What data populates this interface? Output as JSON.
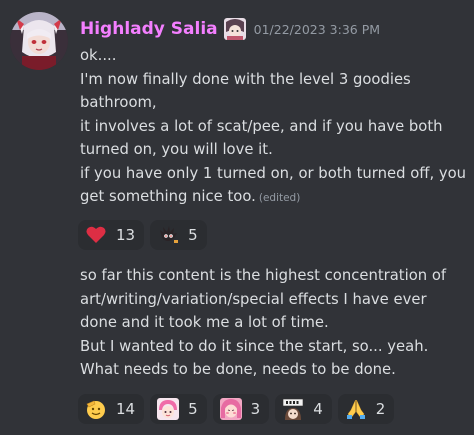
{
  "message": {
    "author": "Highlady Salia",
    "timestamp": "01/22/2023 3:36 PM",
    "author_color": "#f47fff",
    "avatar_icon": "anime-girl-avatar",
    "role_icon": "anime-character-role-icon",
    "paragraph1": [
      "ok....",
      "I'm now finally done with the level 3 goodies",
      "bathroom,",
      "it involves a lot of scat/pee, and if you have both",
      "turned on, you will love it.",
      "if you have only 1 turned on, or both turned off, you",
      "get something nice too."
    ],
    "edited_label": "(edited)",
    "reactions1": [
      {
        "icon": "red-heart-emoji",
        "count": "13"
      },
      {
        "icon": "dark-creature-emoji",
        "count": "5"
      }
    ],
    "paragraph2": [
      "so far this content is the highest concentration of",
      "art/writing/variation/special effects I have ever",
      "done and it took me a lot of time.",
      "But I wanted to do it since the start, so... yeah.",
      "What needs to be done, needs to be done."
    ],
    "reactions2": [
      {
        "icon": "saluting-face-emoji",
        "count": "14"
      },
      {
        "icon": "pink-hair-character-emoji",
        "count": "5"
      },
      {
        "icon": "pink-blush-character-emoji",
        "count": "3"
      },
      {
        "icon": "peek-character-emoji",
        "count": "4"
      },
      {
        "icon": "folded-hands-emoji",
        "count": "2"
      }
    ]
  }
}
